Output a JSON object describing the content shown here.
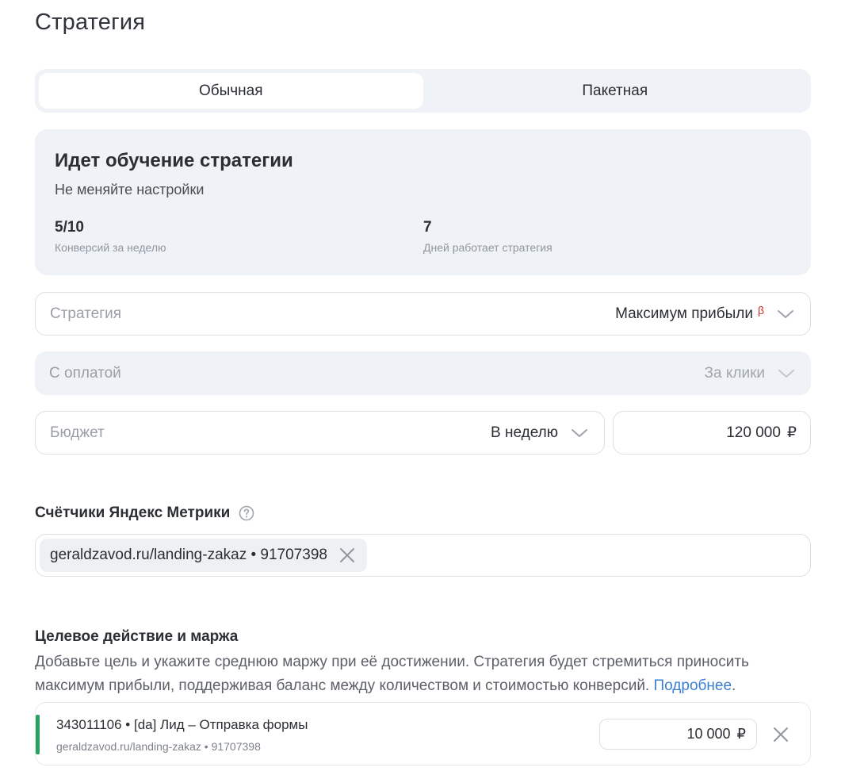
{
  "page": {
    "title": "Стратегия"
  },
  "mode_tabs": [
    {
      "label": "Обычная",
      "active": true
    },
    {
      "label": "Пакетная",
      "active": false
    }
  ],
  "learning": {
    "title": "Идет обучение стратегии",
    "subtitle": "Не меняйте настройки",
    "stats": [
      {
        "value": "5/10",
        "label": "Конверсий за неделю"
      },
      {
        "value": "7",
        "label": "Дней работает стратегия"
      }
    ]
  },
  "strategy_field": {
    "label": "Стратегия",
    "value": "Максимум прибыли",
    "badge": "β"
  },
  "payment_field": {
    "label": "С оплатой",
    "value": "За клики",
    "disabled": true
  },
  "budget_field": {
    "label": "Бюджет",
    "period": "В неделю",
    "amount": "120 000",
    "currency": "₽"
  },
  "counters": {
    "title": "Счётчики Яндекс Метрики",
    "chips": [
      {
        "label": "geraldzavod.ru/landing-zakaz • 91707398"
      }
    ]
  },
  "goals": {
    "title": "Целевое действие и маржа",
    "description": "Добавьте цель и укажите среднюю маржу при её достижении. Стратегия будет стремиться приносить максимум прибыли, поддерживая баланс между количеством и стоимостью конверсий.",
    "link_text": "Подробнее",
    "items": [
      {
        "name": "343011106 • [da] Лид – Отправка формы",
        "site": "geraldzavod.ru/landing-zakaz • 91707398",
        "margin": "10 000",
        "currency": "₽"
      }
    ]
  },
  "colors": {
    "accent_green": "#2aa05e",
    "link_blue": "#3a7fd0",
    "beta_red": "#d6302d",
    "panel_bg": "#eff2f6"
  },
  "icons": {
    "dropdown": "chevron-down-icon",
    "help": "question-circle-icon",
    "remove": "close-icon"
  }
}
